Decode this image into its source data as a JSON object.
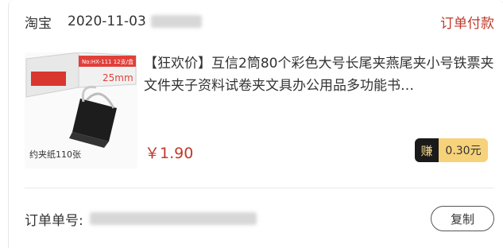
{
  "order": {
    "platform": "淘宝",
    "date": "2020-11-03",
    "status": "订单付款",
    "product": {
      "title": "【狂欢价】互信2筒80个彩色大号长尾夹燕尾夹小号铁票夹文件夹子资料试卷夹文具办公用品多功能书…",
      "price": "￥1.90",
      "image": {
        "model_text": "No:HX-111 12支/盒",
        "size_text": "25mm",
        "capacity_text": "约夹纸110张"
      }
    },
    "earn": {
      "label": "赚",
      "value": "0.30元"
    },
    "order_number_label": "订单单号:",
    "copy_button": "复制"
  },
  "colors": {
    "accent": "#c0392b",
    "earn_badge": "#f6d27a",
    "earn_label_bg": "#1a1a1a"
  }
}
